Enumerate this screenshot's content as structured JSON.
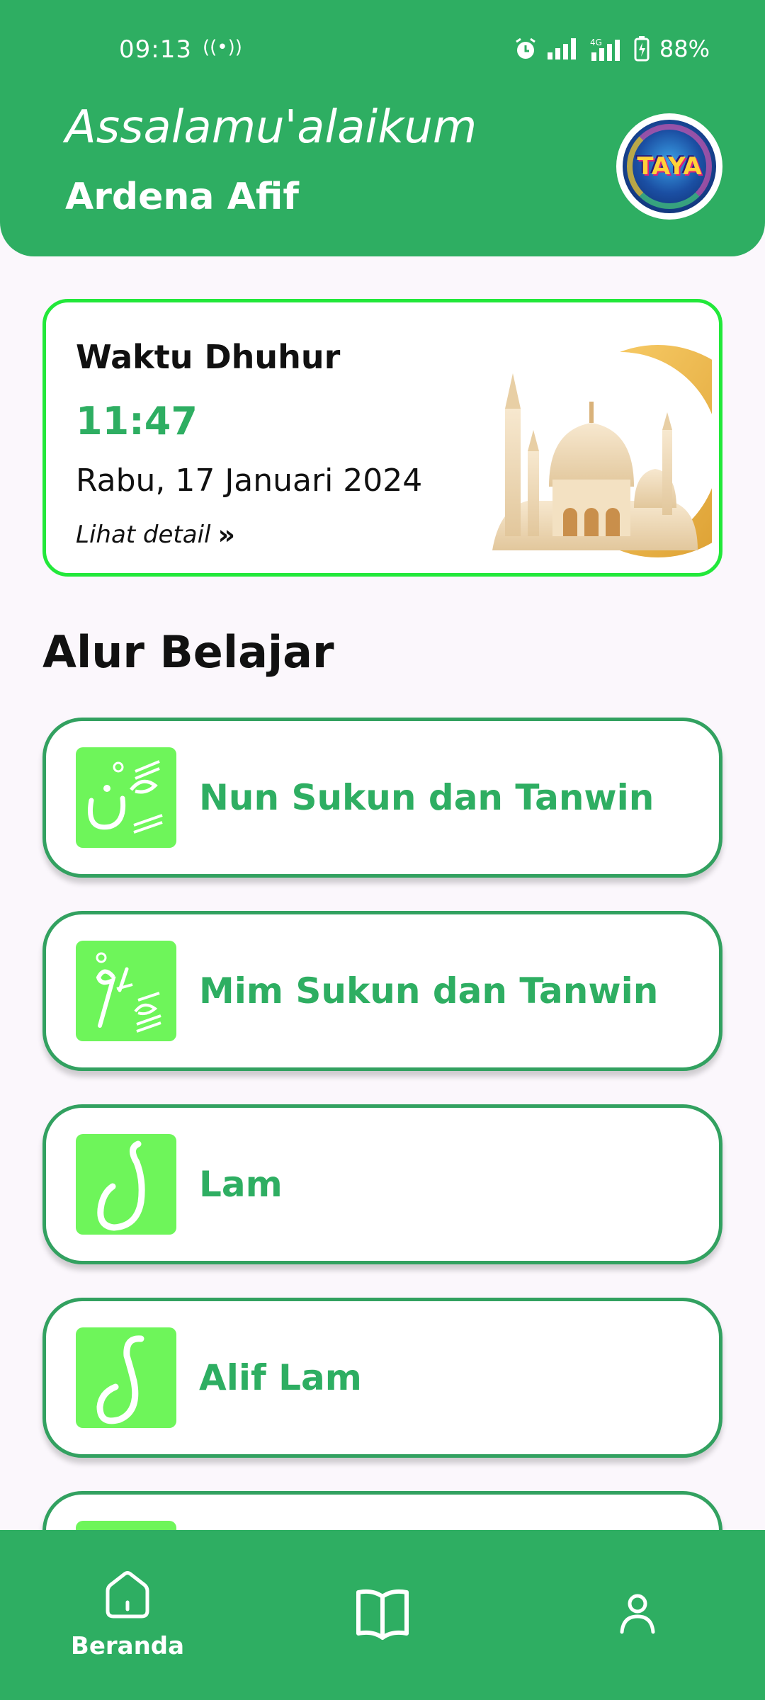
{
  "status_bar": {
    "time": "09:13",
    "battery": "88%",
    "network": "4G"
  },
  "header": {
    "greeting": "Assalamu'alaikum",
    "username": "Ardena Afif",
    "avatar_text": "TAYA"
  },
  "prayer_card": {
    "title": "Waktu Dhuhur",
    "time": "11:47",
    "date": "Rabu, 17 Januari 2024",
    "detail_link": "Lihat detail",
    "detail_chevron": "»"
  },
  "section": {
    "title": "Alur Belajar"
  },
  "lessons": [
    {
      "label": "Nun Sukun dan Tanwin",
      "icon": "nun-sukun-glyph-icon"
    },
    {
      "label": "Mim Sukun dan Tanwin",
      "icon": "mim-sukun-glyph-icon"
    },
    {
      "label": "Lam",
      "icon": "lam-glyph-icon"
    },
    {
      "label": "Alif Lam",
      "icon": "alif-lam-glyph-icon"
    },
    {
      "label": "",
      "icon": "lesson-glyph-icon"
    }
  ],
  "bottom_nav": {
    "items": [
      {
        "label": "Beranda",
        "icon": "home-icon",
        "active": true
      },
      {
        "label": "",
        "icon": "book-icon",
        "active": false
      },
      {
        "label": "",
        "icon": "profile-icon",
        "active": false
      }
    ]
  },
  "colors": {
    "primary": "#2eae62",
    "card_border": "#22e83a",
    "icon_bg": "#6ef55a",
    "background": "#fbf7fc"
  }
}
